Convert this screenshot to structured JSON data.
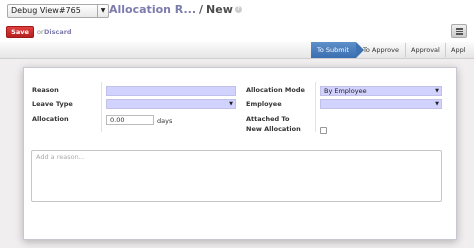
{
  "header": {
    "debug_select_value": "Debug View#765",
    "breadcrumb_parent": "Allocation R...",
    "breadcrumb_separator": "/",
    "breadcrumb_current": "New",
    "help_icon": "?"
  },
  "toolbar": {
    "save_label": "Save",
    "or_text": "or",
    "discard_label": "Discard"
  },
  "statusbar": {
    "stages": [
      "To Submit",
      "To Approve",
      "Approval",
      "Appl"
    ],
    "active_stage": "To Submit"
  },
  "form": {
    "reason_label": "Reason",
    "leave_type_label": "Leave Type",
    "allocation_label": "Allocation",
    "allocation_value": "0.00",
    "days_label": "days",
    "allocation_mode_label": "Allocation Mode",
    "allocation_mode_value": "By Employee",
    "employee_label": "Employee",
    "attached_to_label": "Attached To",
    "new_allocation_label": "New Allocation",
    "notes_placeholder": "Add a reason..."
  },
  "colors": {
    "accent": "#7c7bad",
    "save_button": "#c32a2a",
    "required_field": "#d2d2ff",
    "active_stage": "#4a7ec0"
  }
}
